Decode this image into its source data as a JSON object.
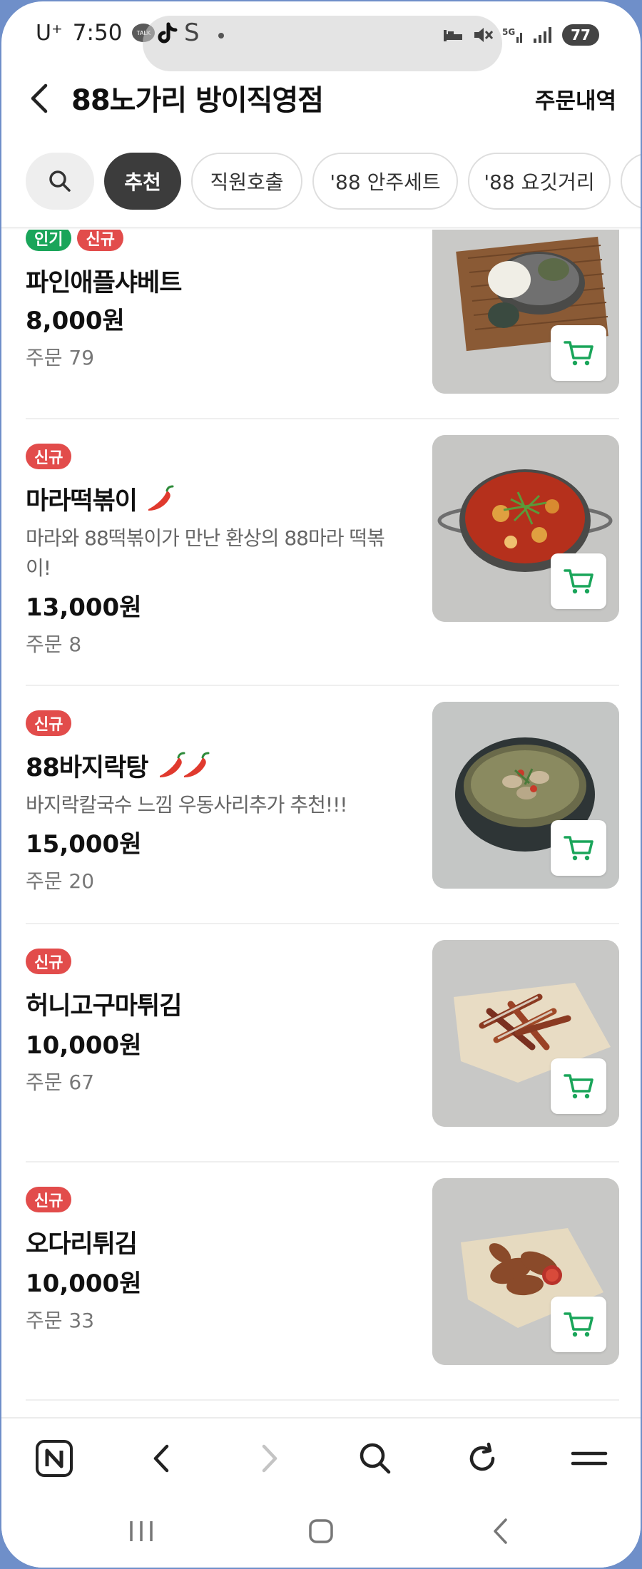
{
  "status_bar": {
    "carrier": "U⁺",
    "time": "7:50",
    "talk_label": "TALK",
    "battery": "77",
    "network": "5G"
  },
  "header": {
    "title": "88노가리 방이직영점",
    "order_history": "주문내역"
  },
  "categories": [
    "추천",
    "직원호출",
    "'88 안주세트",
    "'88 요깃거리"
  ],
  "menu_items": [
    {
      "badges": [
        "인기",
        "신규"
      ],
      "name": "파인애플샤베트",
      "price": "8,000원",
      "orders": "주문 79",
      "image_icon": "pineapple-sherbet-photo"
    },
    {
      "badges": [
        "신규"
      ],
      "name": "마라떡볶이",
      "spicy": 1,
      "description": "마라와 88떡볶이가 만난 환상의 88마라 떡볶이!",
      "price": "13,000원",
      "orders": "주문 8",
      "image_icon": "mala-tteokbokki-photo"
    },
    {
      "badges": [
        "신규"
      ],
      "name": "88바지락탕",
      "spicy": 2,
      "description": "바지락칼국수 느낌 우동사리추가 추천!!!",
      "price": "15,000원",
      "orders": "주문 20",
      "image_icon": "clam-soup-photo"
    },
    {
      "badges": [
        "신규"
      ],
      "name": "허니고구마튀김",
      "price": "10,000원",
      "orders": "주문 67",
      "image_icon": "honey-sweet-potato-fries-photo"
    },
    {
      "badges": [
        "신규"
      ],
      "name": "오다리튀김",
      "price": "10,000원",
      "orders": "주문 33",
      "image_icon": "fried-squid-legs-photo"
    }
  ],
  "browser_toolbar": [
    "naver-home-icon",
    "back-icon",
    "forward-icon",
    "search-icon",
    "refresh-icon",
    "menu-icon"
  ],
  "system_nav": [
    "recent-apps-icon",
    "home-icon",
    "back-icon"
  ],
  "colors": {
    "badge_popular": "#1aa55a",
    "badge_new": "#e24c4b",
    "cart_green": "#1aa55a",
    "chip_active": "#3c3c3c"
  }
}
